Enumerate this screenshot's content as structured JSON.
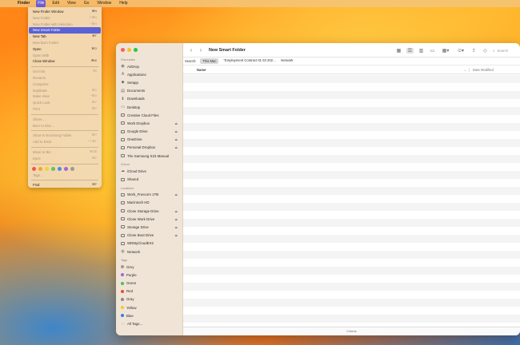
{
  "menubar": {
    "items": [
      "Finder",
      "File",
      "Edit",
      "View",
      "Go",
      "Window",
      "Help"
    ]
  },
  "file_menu": {
    "items": [
      {
        "label": "New Finder Window",
        "shortcut": "⌘N",
        "disabled": false
      },
      {
        "label": "New Folder",
        "shortcut": "⇧⌘N",
        "disabled": true
      },
      {
        "label": "New Folder with Selection",
        "shortcut": "^⌘N",
        "disabled": true
      },
      {
        "label": "New Smart Folder",
        "shortcut": "",
        "disabled": false,
        "highlighted": true
      },
      {
        "label": "New Tab",
        "shortcut": "⌘T",
        "disabled": false
      },
      {
        "label": "New Burn Folder",
        "shortcut": "",
        "disabled": true
      },
      {
        "label": "Open",
        "shortcut": "⌘O",
        "disabled": false
      },
      {
        "label": "Open With",
        "shortcut": "",
        "disabled": true
      },
      {
        "label": "Close Window",
        "shortcut": "⌘W",
        "disabled": false
      },
      {
        "sep": true
      },
      {
        "label": "Get Info",
        "shortcut": "⌘I",
        "disabled": true
      },
      {
        "label": "Rename",
        "shortcut": "",
        "disabled": true
      },
      {
        "label": "Compress",
        "shortcut": "",
        "disabled": true
      },
      {
        "label": "Duplicate",
        "shortcut": "⌘D",
        "disabled": true
      },
      {
        "label": "Make Alias",
        "shortcut": "^⌘A",
        "disabled": true
      },
      {
        "label": "Quick Look",
        "shortcut": "⌘Y",
        "disabled": true
      },
      {
        "label": "Print",
        "shortcut": "⌘P",
        "disabled": true
      },
      {
        "sep": true
      },
      {
        "label": "Share…",
        "shortcut": "",
        "disabled": true
      },
      {
        "label": "Burn to Disc…",
        "shortcut": "",
        "disabled": true
      },
      {
        "sep": true
      },
      {
        "label": "Show in Enclosing Folder",
        "shortcut": "⌘R",
        "disabled": true
      },
      {
        "label": "Add to Dock",
        "shortcut": "^⇧⌘T",
        "disabled": true
      },
      {
        "sep": true
      },
      {
        "label": "Move to Bin",
        "shortcut": "⌘⌫",
        "disabled": true
      },
      {
        "label": "Eject",
        "shortcut": "⌘E",
        "disabled": true
      },
      {
        "sep": true
      },
      {
        "tags": true
      },
      {
        "label": "Tags…",
        "shortcut": "",
        "disabled": true
      },
      {
        "sep": true
      },
      {
        "label": "Find",
        "shortcut": "⌘F",
        "disabled": false
      }
    ],
    "tag_colors": [
      "#f05a4a",
      "#f2a43a",
      "#f0d23a",
      "#5bc65b",
      "#4a8af0",
      "#a166d6",
      "#9a9a9a"
    ]
  },
  "window": {
    "title": "New Smart Folder",
    "search_placeholder": "Search",
    "scope": {
      "label": "Search:",
      "options": [
        "This Mac",
        "\"Employment Contract 01 03 202…",
        "Network"
      ],
      "selected": 0
    },
    "columns": {
      "name": "Name",
      "date": "Date Modified"
    },
    "status": "0 items",
    "row_count": 31
  },
  "sidebar": {
    "sections": [
      {
        "title": "Favourites",
        "items": [
          {
            "label": "AirDrop",
            "icon": "airdrop-icon",
            "glyph": "◉"
          },
          {
            "label": "Applications",
            "icon": "applications-icon",
            "glyph": "A"
          },
          {
            "label": "Setapp",
            "icon": "setapp-icon",
            "glyph": "◆"
          },
          {
            "label": "Documents",
            "icon": "documents-icon",
            "glyph": "▤"
          },
          {
            "label": "Downloads",
            "icon": "downloads-icon",
            "glyph": "⬇"
          },
          {
            "label": "Desktop",
            "icon": "desktop-icon",
            "glyph": "▭"
          },
          {
            "label": "Creative Cloud Files",
            "icon": "folder-icon",
            "box": true
          },
          {
            "label": "Work Dropbox",
            "icon": "folder-icon",
            "box": true,
            "eject": true
          },
          {
            "label": "Google Drive",
            "icon": "folder-icon",
            "box": true,
            "eject": true
          },
          {
            "label": "OneDrive",
            "icon": "folder-icon",
            "box": true,
            "eject": true
          },
          {
            "label": "Personal Dropbox",
            "icon": "folder-icon",
            "box": true,
            "eject": true
          },
          {
            "label": "The Samsung S23 Manual",
            "icon": "folder-icon",
            "box": true
          }
        ]
      },
      {
        "title": "iCloud",
        "items": [
          {
            "label": "iCloud Drive",
            "icon": "cloud-icon",
            "glyph": "☁"
          },
          {
            "label": "Shared",
            "icon": "shared-folder-icon",
            "box": true
          }
        ]
      },
      {
        "title": "Locations",
        "items": [
          {
            "label": "Work_Freecom 1TB",
            "icon": "drive-icon",
            "box": true,
            "eject": true
          },
          {
            "label": "Macintosh HD",
            "icon": "drive-icon",
            "box": true
          },
          {
            "label": "Clone Storage Drive",
            "icon": "drive-icon",
            "box": true,
            "eject": true
          },
          {
            "label": "Clone Work Drive",
            "icon": "drive-icon",
            "box": true,
            "eject": true
          },
          {
            "label": "Storage Drive",
            "icon": "drive-icon",
            "box": true,
            "eject": true
          },
          {
            "label": "Clone Boot Drive",
            "icon": "drive-icon",
            "box": true,
            "eject": true
          },
          {
            "label": "WDMyCloudEX2",
            "icon": "network-drive-icon",
            "box": true
          },
          {
            "label": "Network",
            "icon": "network-icon",
            "glyph": "◍"
          }
        ]
      },
      {
        "title": "Tags",
        "items": [
          {
            "label": "Grey",
            "color": "#9a9a9a"
          },
          {
            "label": "Purple",
            "color": "#a166d6"
          },
          {
            "label": "Green",
            "color": "#4fbf4f"
          },
          {
            "label": "Red",
            "color": "#ef4a3c"
          },
          {
            "label": "Gray",
            "color": "#8a8a8a"
          },
          {
            "label": "Yellow",
            "color": "#f0c92e"
          },
          {
            "label": "Blue",
            "color": "#3a7af0"
          },
          {
            "label": "All Tags…",
            "icon": "all-tags-icon",
            "glyph": "◌"
          }
        ]
      }
    ]
  },
  "colors": {
    "menu_highlight": "#5a62d6",
    "close": "#ff5f57",
    "minimize": "#febc2e",
    "zoom": "#28c840"
  }
}
